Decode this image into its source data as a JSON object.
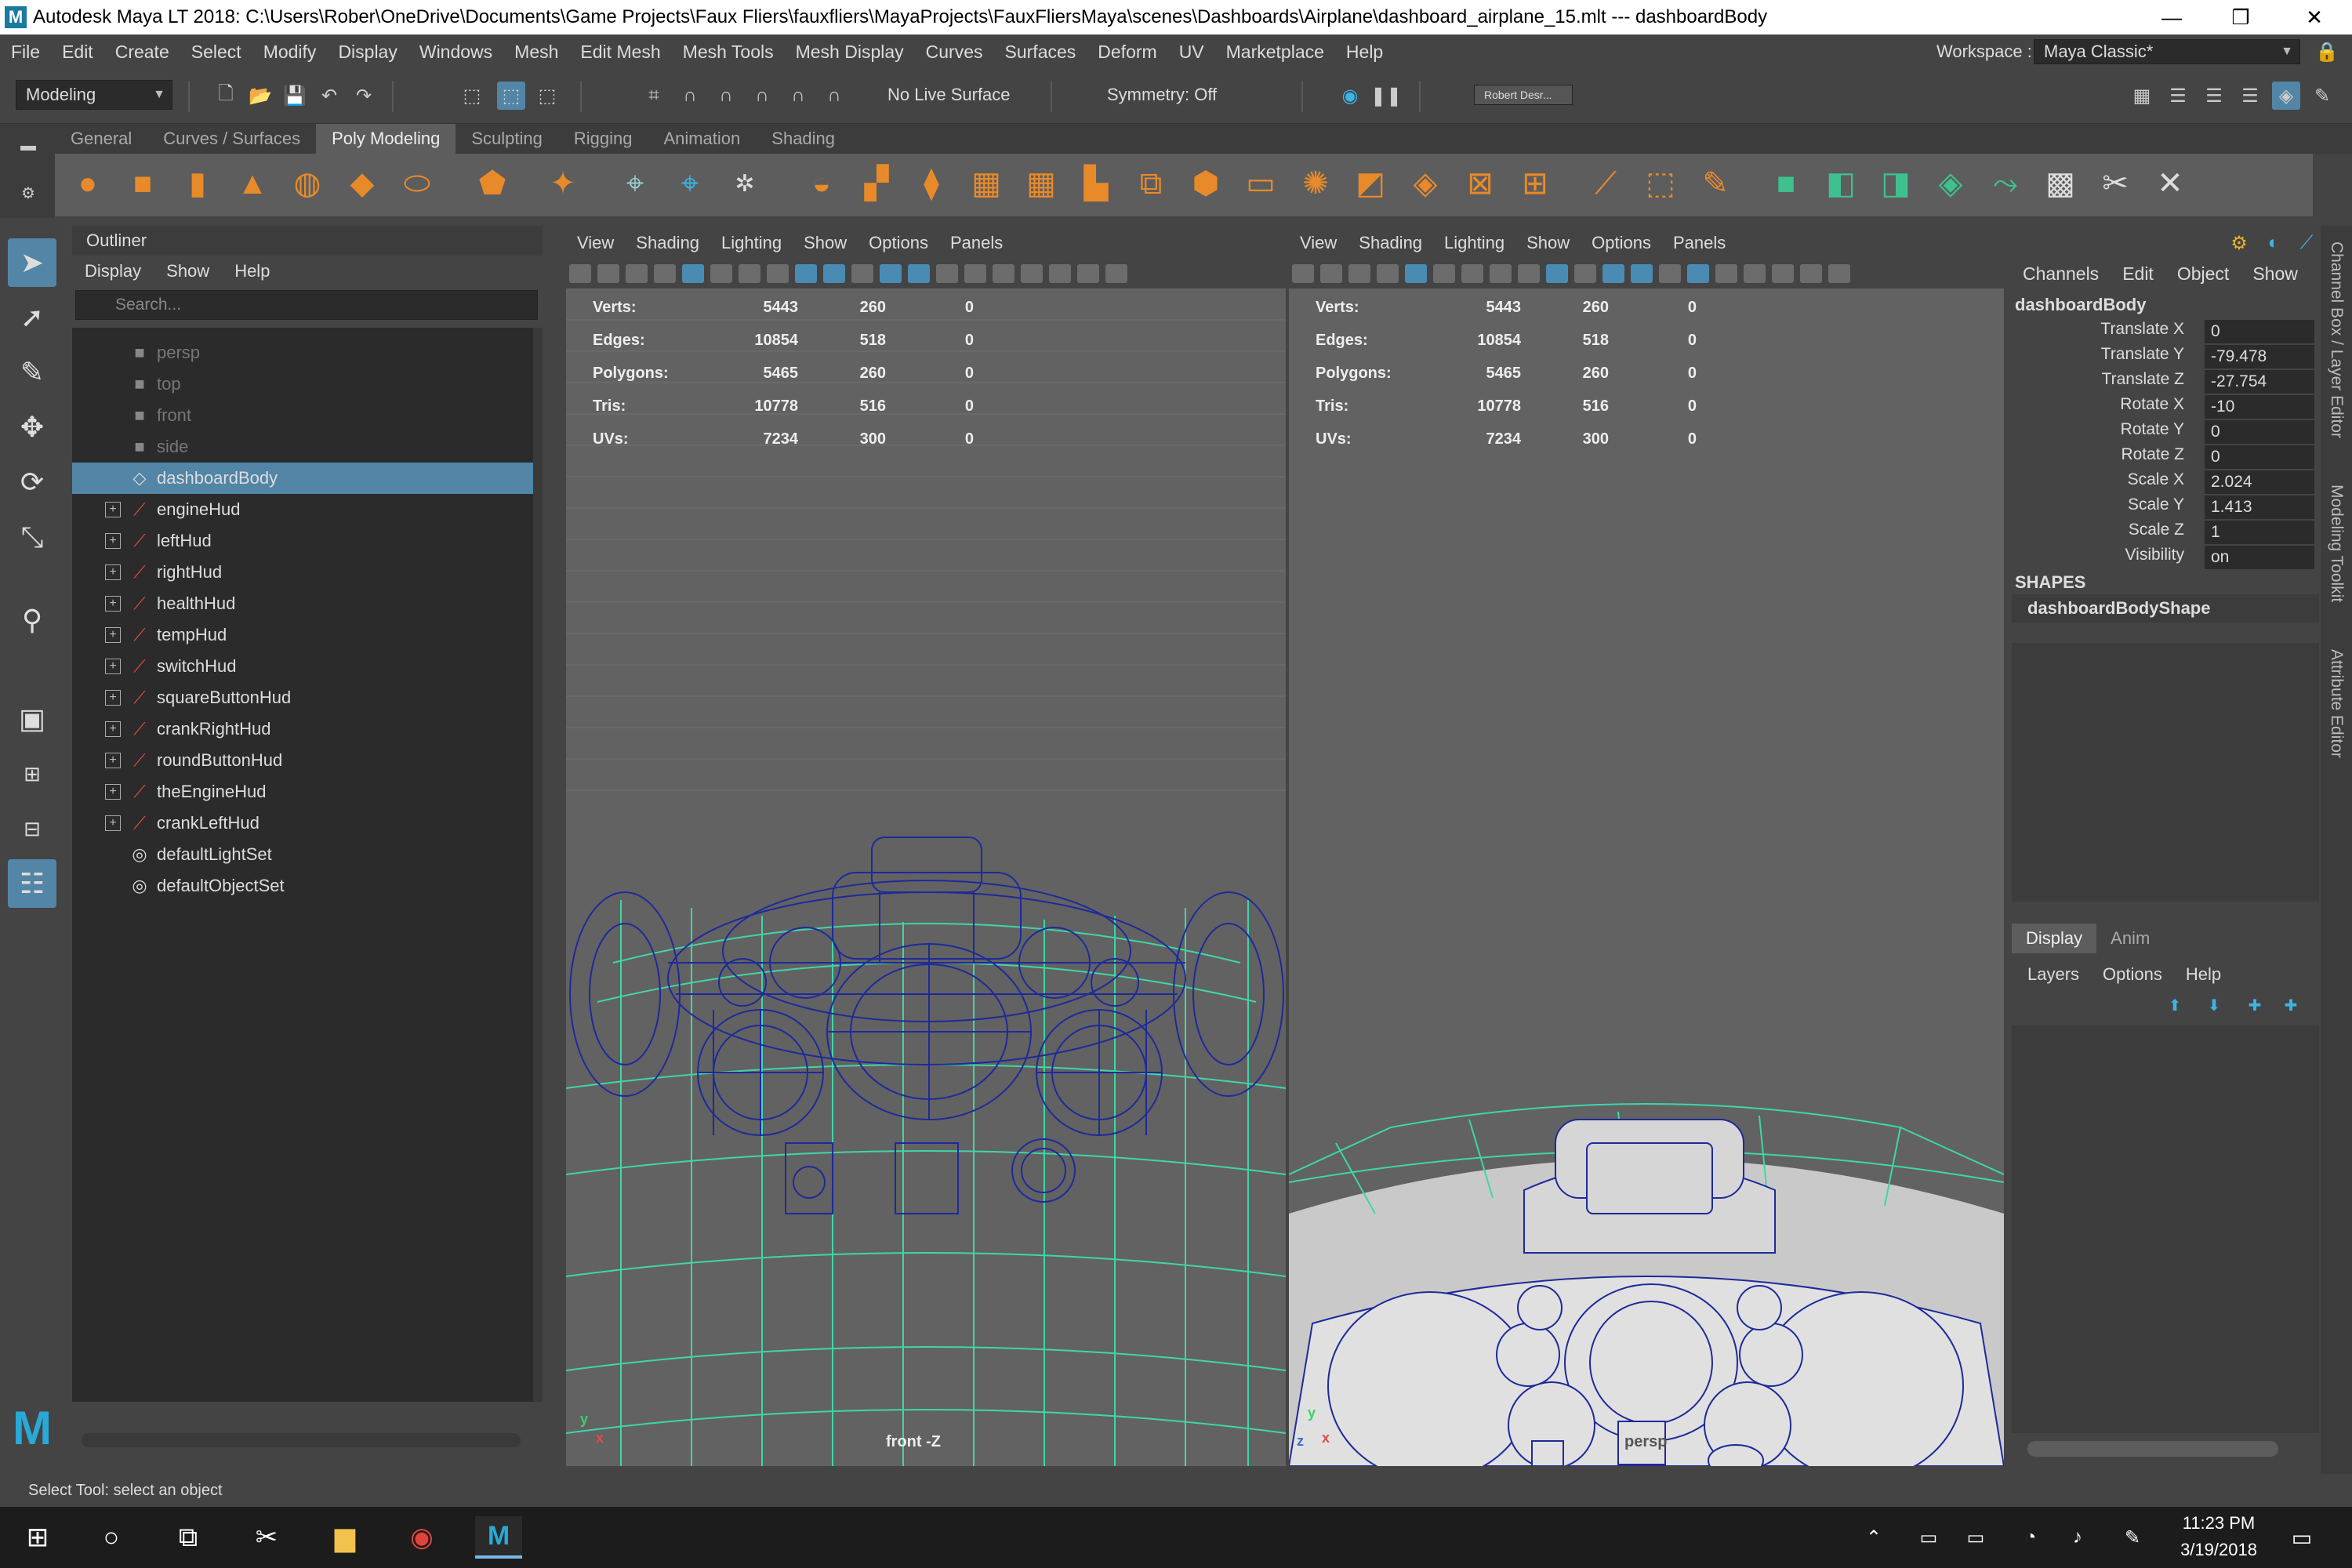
{
  "window": {
    "title": "Autodesk Maya LT 2018: C:\\Users\\Rober\\OneDrive\\Documents\\Game Projects\\Faux Fliers\\fauxfliers\\MayaProjects\\FauxFliersMaya\\scenes\\Dashboards\\Airplane\\dashboard_airplane_15.mlt  ---  dashboardBody",
    "logo": "M",
    "minimize": "—",
    "restore": "❐",
    "close": "✕"
  },
  "menubar": [
    "File",
    "Edit",
    "Create",
    "Select",
    "Modify",
    "Display",
    "Windows",
    "Mesh",
    "Edit Mesh",
    "Mesh Tools",
    "Mesh Display",
    "Curves",
    "Surfaces",
    "Deform",
    "UV",
    "Marketplace",
    "Help"
  ],
  "workspace": {
    "label": "Workspace :",
    "value": "Maya Classic*"
  },
  "statusline": {
    "mode": "Modeling",
    "live_surface": "No Live Surface",
    "symmetry": "Symmetry: Off",
    "account": "Robert Desr..."
  },
  "shelf": {
    "tabs": [
      "General",
      "Curves / Surfaces",
      "Poly Modeling",
      "Sculpting",
      "Rigging",
      "Animation",
      "Shading"
    ],
    "active_tab": "Poly Modeling"
  },
  "outliner": {
    "title": "Outliner",
    "menu": [
      "Display",
      "Show",
      "Help"
    ],
    "search_placeholder": "Search...",
    "items": [
      {
        "label": "persp",
        "type": "camera",
        "dim": true,
        "expand": false,
        "selected": false
      },
      {
        "label": "top",
        "type": "camera",
        "dim": true,
        "expand": false,
        "selected": false
      },
      {
        "label": "front",
        "type": "camera",
        "dim": true,
        "expand": false,
        "selected": false
      },
      {
        "label": "side",
        "type": "camera",
        "dim": true,
        "expand": false,
        "selected": false
      },
      {
        "label": "dashboardBody",
        "type": "mesh",
        "dim": false,
        "expand": false,
        "selected": true
      },
      {
        "label": "engineHud",
        "type": "group",
        "dim": false,
        "expand": true,
        "selected": false
      },
      {
        "label": "leftHud",
        "type": "group",
        "dim": false,
        "expand": true,
        "selected": false
      },
      {
        "label": "rightHud",
        "type": "group",
        "dim": false,
        "expand": true,
        "selected": false
      },
      {
        "label": "healthHud",
        "type": "group",
        "dim": false,
        "expand": true,
        "selected": false
      },
      {
        "label": "tempHud",
        "type": "group",
        "dim": false,
        "expand": true,
        "selected": false
      },
      {
        "label": "switchHud",
        "type": "group",
        "dim": false,
        "expand": true,
        "selected": false
      },
      {
        "label": "squareButtonHud",
        "type": "group",
        "dim": false,
        "expand": true,
        "selected": false
      },
      {
        "label": "crankRightHud",
        "type": "group",
        "dim": false,
        "expand": true,
        "selected": false
      },
      {
        "label": "roundButtonHud",
        "type": "group",
        "dim": false,
        "expand": true,
        "selected": false
      },
      {
        "label": "theEngineHud",
        "type": "group",
        "dim": false,
        "expand": true,
        "selected": false
      },
      {
        "label": "crankLeftHud",
        "type": "group",
        "dim": false,
        "expand": true,
        "selected": false
      },
      {
        "label": "defaultLightSet",
        "type": "set",
        "dim": false,
        "expand": false,
        "selected": false
      },
      {
        "label": "defaultObjectSet",
        "type": "set",
        "dim": false,
        "expand": false,
        "selected": false
      }
    ]
  },
  "viewport_menu": [
    "View",
    "Shading",
    "Lighting",
    "Show",
    "Options",
    "Panels"
  ],
  "hud": {
    "rows": [
      {
        "label": "Verts:",
        "a": "5443",
        "b": "260",
        "c": "0"
      },
      {
        "label": "Edges:",
        "a": "10854",
        "b": "518",
        "c": "0"
      },
      {
        "label": "Polygons:",
        "a": "5465",
        "b": "260",
        "c": "0"
      },
      {
        "label": "Tris:",
        "a": "10778",
        "b": "516",
        "c": "0"
      },
      {
        "label": "UVs:",
        "a": "7234",
        "b": "300",
        "c": "0"
      }
    ]
  },
  "viewports": {
    "left_camera": "front -Z",
    "right_camera": "persp"
  },
  "channel_box": {
    "menu": [
      "Channels",
      "Edit",
      "Object",
      "Show"
    ],
    "object": "dashboardBody",
    "attrs": [
      {
        "k": "Translate X",
        "v": "0"
      },
      {
        "k": "Translate Y",
        "v": "-79.478"
      },
      {
        "k": "Translate Z",
        "v": "-27.754"
      },
      {
        "k": "Rotate X",
        "v": "-10"
      },
      {
        "k": "Rotate Y",
        "v": "0"
      },
      {
        "k": "Rotate Z",
        "v": "0"
      },
      {
        "k": "Scale X",
        "v": "2.024"
      },
      {
        "k": "Scale Y",
        "v": "1.413"
      },
      {
        "k": "Scale Z",
        "v": "1"
      },
      {
        "k": "Visibility",
        "v": "on"
      }
    ],
    "shapes_label": "SHAPES",
    "shape": "dashboardBodyShape"
  },
  "layer_editor": {
    "tabs": [
      "Display",
      "Anim"
    ],
    "menu": [
      "Layers",
      "Options",
      "Help"
    ]
  },
  "side_tabs": [
    "Channel Box / Layer Editor",
    "Modeling Toolkit",
    "Attribute Editor"
  ],
  "help_line": "Select Tool: select an object",
  "taskbar": {
    "time": "11:23 PM",
    "date": "3/19/2018"
  },
  "colors": {
    "accent": "#5285a6",
    "wire": "#1e2a9a",
    "grid": "#3fd6a8",
    "shelf": "#e98a2a"
  }
}
